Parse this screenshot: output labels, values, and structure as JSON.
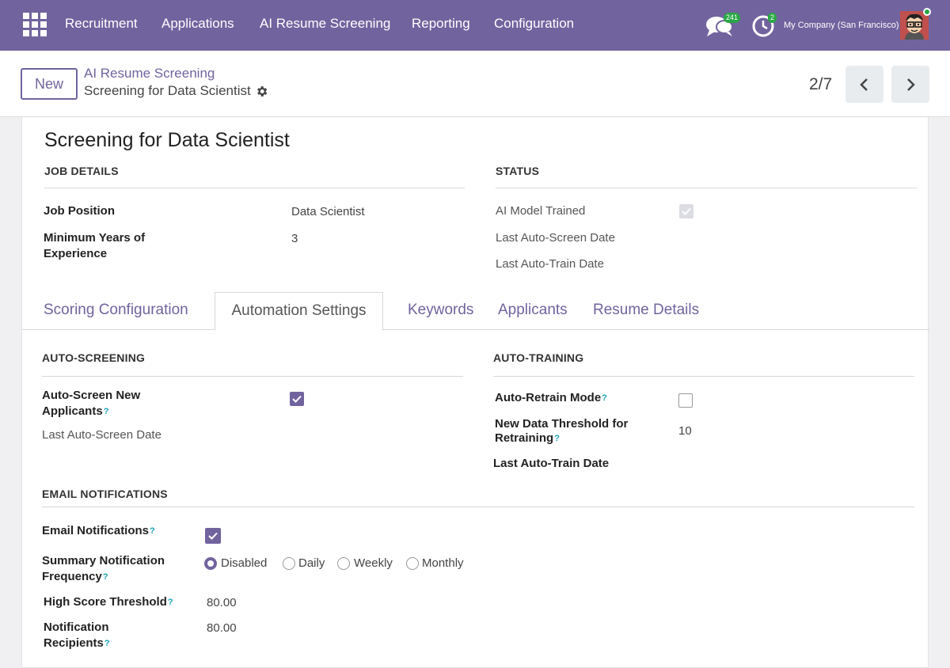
{
  "navbar": {
    "menu": [
      "Recruitment",
      "Applications",
      "AI Resume Screening",
      "Reporting",
      "Configuration"
    ],
    "chat_count": "241",
    "activity_count": "2",
    "company": "My Company (San Francisco)"
  },
  "control": {
    "new_label": "New",
    "breadcrumb_parent": "AI Resume Screening",
    "breadcrumb_current": "Screening for Data Scientist",
    "pager": "2/7"
  },
  "form": {
    "title": "Screening for Data Scientist",
    "job_details": {
      "heading": "JOB DETAILS",
      "job_position_label": "Job Position",
      "job_position_value": "Data Scientist",
      "min_years_label_1": "Minimum Years of",
      "min_years_label_2": "Experience",
      "min_years_value": "3"
    },
    "status": {
      "heading": "STATUS",
      "ai_model_trained_label": "AI Model Trained",
      "ai_model_trained": true,
      "last_auto_screen_label": "Last Auto-Screen Date",
      "last_auto_train_label": "Last Auto-Train Date"
    },
    "tabs": [
      "Scoring Configuration",
      "Automation Settings",
      "Keywords",
      "Applicants",
      "Resume Details"
    ],
    "active_tab": "Automation Settings",
    "auto_screening": {
      "heading": "AUTO-SCREENING",
      "auto_screen_label_1": "Auto-Screen New",
      "auto_screen_label_2": "Applicants",
      "auto_screen_checked": true,
      "last_auto_screen_label": "Last Auto-Screen Date"
    },
    "auto_training": {
      "heading": "AUTO-TRAINING",
      "retrain_mode_label": "Auto-Retrain Mode",
      "retrain_mode_checked": false,
      "threshold_label_1": "New Data Threshold for",
      "threshold_label_2": "Retraining",
      "threshold_value": "10",
      "last_auto_train_label": "Last Auto-Train Date"
    },
    "email_notifications": {
      "heading": "EMAIL NOTIFICATIONS",
      "email_label": "Email Notifications",
      "email_checked": true,
      "frequency_label_1": "Summary Notification",
      "frequency_label_2": "Frequency",
      "frequency_options": [
        "Disabled",
        "Daily",
        "Weekly",
        "Monthly"
      ],
      "frequency_selected": "Disabled",
      "high_score_label": "High Score Threshold",
      "high_score_value": "80.00",
      "recipients_label_1": "Notification",
      "recipients_label_2": "Recipients",
      "recipients_value": "80.00"
    },
    "help_mark": "?"
  },
  "colors": {
    "brand": "#71639e",
    "help": "#17a2b8",
    "badge": "#28a745"
  }
}
